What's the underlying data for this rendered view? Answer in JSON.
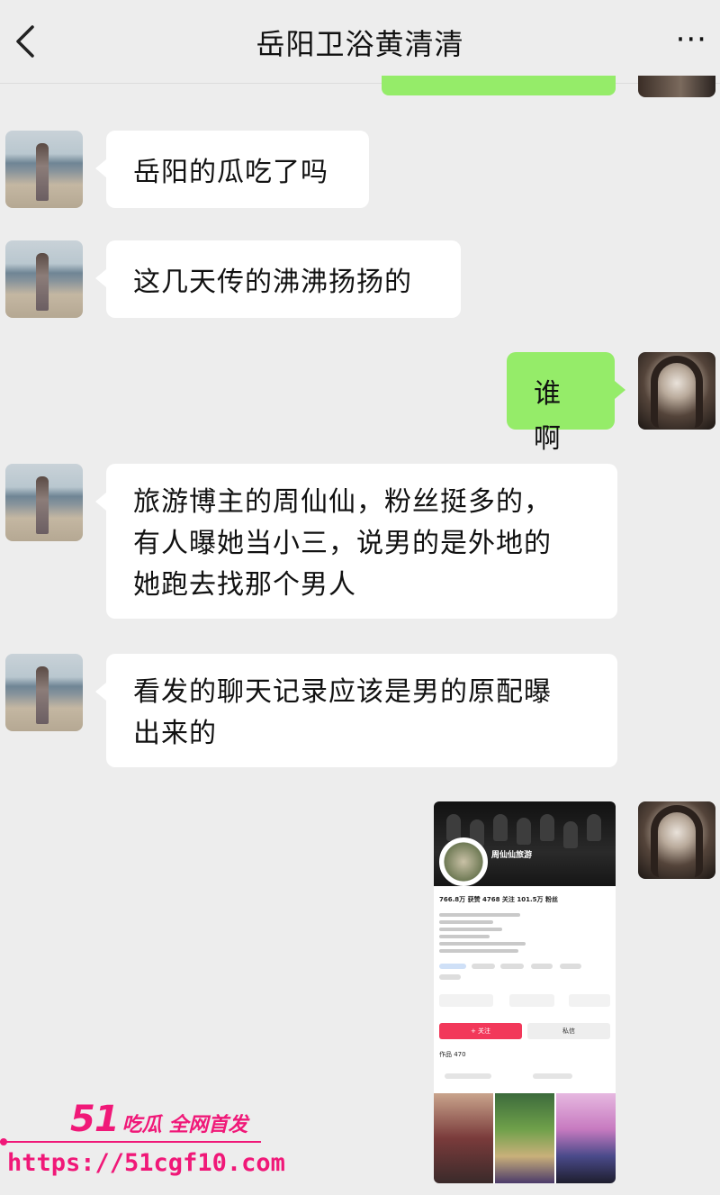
{
  "header": {
    "title": "岳阳卫浴黄清清",
    "more_label": "···"
  },
  "messages": [
    {
      "side": "in",
      "text": "岳阳的瓜吃了吗"
    },
    {
      "side": "in",
      "text": "这几天传的沸沸扬扬的"
    },
    {
      "side": "out",
      "text": "谁啊"
    },
    {
      "side": "in",
      "lines": [
        "旅游博主的周仙仙，粉丝挺多的，",
        "有人曝她当小三，说男的是外地的",
        "她跑去找那个男人"
      ]
    },
    {
      "side": "in",
      "lines": [
        "看发的聊天记录应该是男的原配曝",
        "出来的"
      ]
    }
  ],
  "shared_image": {
    "profile_name": "周仙仙旅游",
    "stats": "766.8万 获赞  4768 关注  101.5万 粉丝",
    "follow_label": "+ 关注",
    "message_label": "私信",
    "works_label": "作品 470"
  },
  "watermark": {
    "brand": "51",
    "tagline": "吃瓜 全网首发",
    "url": "https://51cgf10.com",
    "color": "#f01878"
  },
  "colors": {
    "background": "#ededed",
    "outgoing_bubble": "#95ec69",
    "incoming_bubble": "#ffffff"
  }
}
